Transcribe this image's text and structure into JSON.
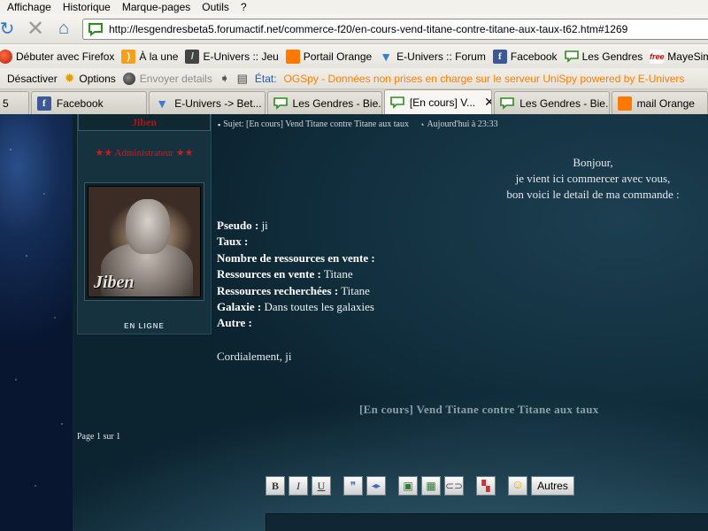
{
  "menubar": {
    "items": [
      "Affichage",
      "Historique",
      "Marque-pages",
      "Outils",
      "?"
    ]
  },
  "navbar": {
    "url": "http://lesgendresbeta5.forumactif.net/commerce-f20/en-cours-vend-titane-contre-titane-aux-taux-t62.htm#1269"
  },
  "bookmarks": [
    {
      "label": "Débuter avec Firefox",
      "icon": "firefox-icon"
    },
    {
      "label": "À la une",
      "icon": "rss-icon"
    },
    {
      "label": "E-Univers :: Jeu",
      "icon": "e-univers-icon"
    },
    {
      "label": "Portail Orange",
      "icon": "orange-icon"
    },
    {
      "label": "E-Univers :: Forum",
      "icon": "e-univers-forum-icon"
    },
    {
      "label": "Facebook",
      "icon": "facebook-icon"
    },
    {
      "label": "Les Gendres",
      "icon": "les-gendres-icon"
    },
    {
      "label": "MayeSim",
      "icon": "free-icon"
    }
  ],
  "exttoolbar": {
    "disable": "Désactiver",
    "options": "Options",
    "send_details": "Envoyer details",
    "state_label": "État:",
    "state_text": "OGSpy - Données non prises en charge sur le serveur UniSpy powered by E-Univers"
  },
  "tabs": [
    {
      "label": "5"
    },
    {
      "label": "Facebook"
    },
    {
      "label": "E-Univers -> Bet..."
    },
    {
      "label": "Les Gendres - Bie..."
    },
    {
      "label": "[En cours] V..."
    },
    {
      "label": "Les Gendres - Bie..."
    },
    {
      "label": "mail Orange"
    }
  ],
  "post": {
    "author": "Jiben",
    "rank": "★★ Administrateur ★★",
    "avatar_label": "Jiben",
    "online": "EN LIGNE",
    "subject": "Sujet: [En cours] Vend Titane contre Titane aux taux",
    "time": "Aujourd'hui à 23:33",
    "greeting": [
      "Bonjour,",
      "je vient ici commercer avec vous,",
      "bon voici le detail de ma commande :"
    ],
    "fields": [
      {
        "label": "Pseudo :",
        "value": "ji"
      },
      {
        "label": "Taux :",
        "value": ""
      },
      {
        "label": "Nombre de ressources en vente :",
        "value": ""
      },
      {
        "label": "Ressources en vente :",
        "value": "Titane"
      },
      {
        "label": "Ressources recherchées :",
        "value": "Titane"
      },
      {
        "label": "Galaxie :",
        "value": "Dans toutes les galaxies"
      },
      {
        "label": "Autre :",
        "value": ""
      }
    ],
    "sign_off": "Cordialement, ji",
    "topic_title": "[En cours] Vend Titane contre Titane aux taux"
  },
  "pagination": {
    "text": "Page 1 sur 1"
  },
  "editor": {
    "bold": "B",
    "italic": "I",
    "underline": "U",
    "others": "Autres"
  }
}
